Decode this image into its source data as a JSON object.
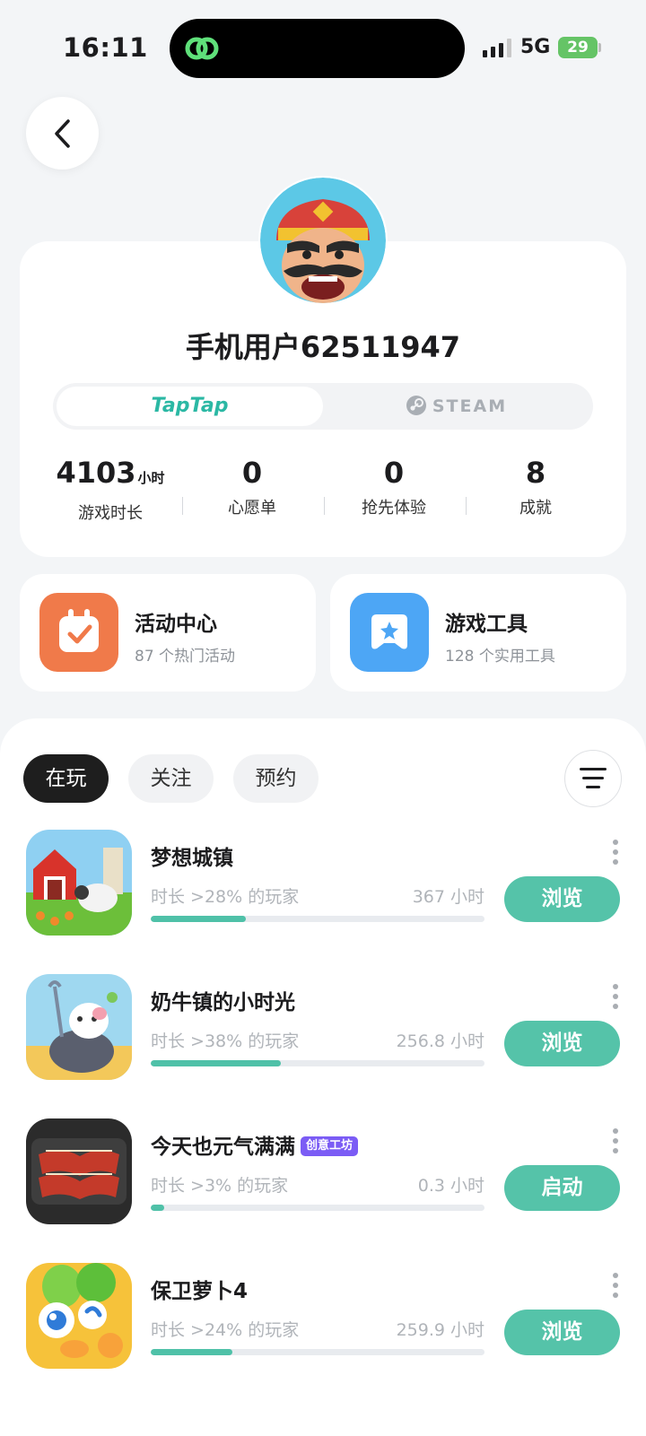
{
  "status_bar": {
    "time": "16:11",
    "network": "5G",
    "battery": "29"
  },
  "profile": {
    "username": "手机用户62511947",
    "platform_tabs": {
      "taptap": "TapTap",
      "steam": "STEAM"
    },
    "stats": [
      {
        "value": "4103",
        "unit": "小时",
        "label": "游戏时长"
      },
      {
        "value": "0",
        "unit": "",
        "label": "心愿单"
      },
      {
        "value": "0",
        "unit": "",
        "label": "抢先体验"
      },
      {
        "value": "8",
        "unit": "",
        "label": "成就"
      }
    ]
  },
  "features": [
    {
      "title": "活动中心",
      "subtitle": "87 个热门活动",
      "icon": "calendar-check-icon",
      "color": "#f07a4a"
    },
    {
      "title": "游戏工具",
      "subtitle": "128 个实用工具",
      "icon": "gamepad-icon",
      "color": "#4da6f5"
    }
  ],
  "list": {
    "tabs": [
      "在玩",
      "关注",
      "预约"
    ],
    "active_tab": 0,
    "games": [
      {
        "name": "梦想城镇",
        "tag": "",
        "rank": "时长 >28% 的玩家",
        "hours": "367 小时",
        "progress": 0.285,
        "action": "浏览"
      },
      {
        "name": "奶牛镇的小时光",
        "tag": "",
        "rank": "时长 >38% 的玩家",
        "hours": "256.8 小时",
        "progress": 0.39,
        "action": "浏览"
      },
      {
        "name": "今天也元气满满",
        "tag": "创意工坊",
        "rank": "时长 >3% 的玩家",
        "hours": "0.3 小时",
        "progress": 0.04,
        "action": "启动"
      },
      {
        "name": "保卫萝卜4",
        "tag": "",
        "rank": "时长 >24% 的玩家",
        "hours": "259.9 小时",
        "progress": 0.245,
        "action": "浏览"
      }
    ]
  },
  "colors": {
    "accent": "#55c3a9",
    "taptap": "#2bb8a4",
    "tag": "#7b5cf5"
  }
}
